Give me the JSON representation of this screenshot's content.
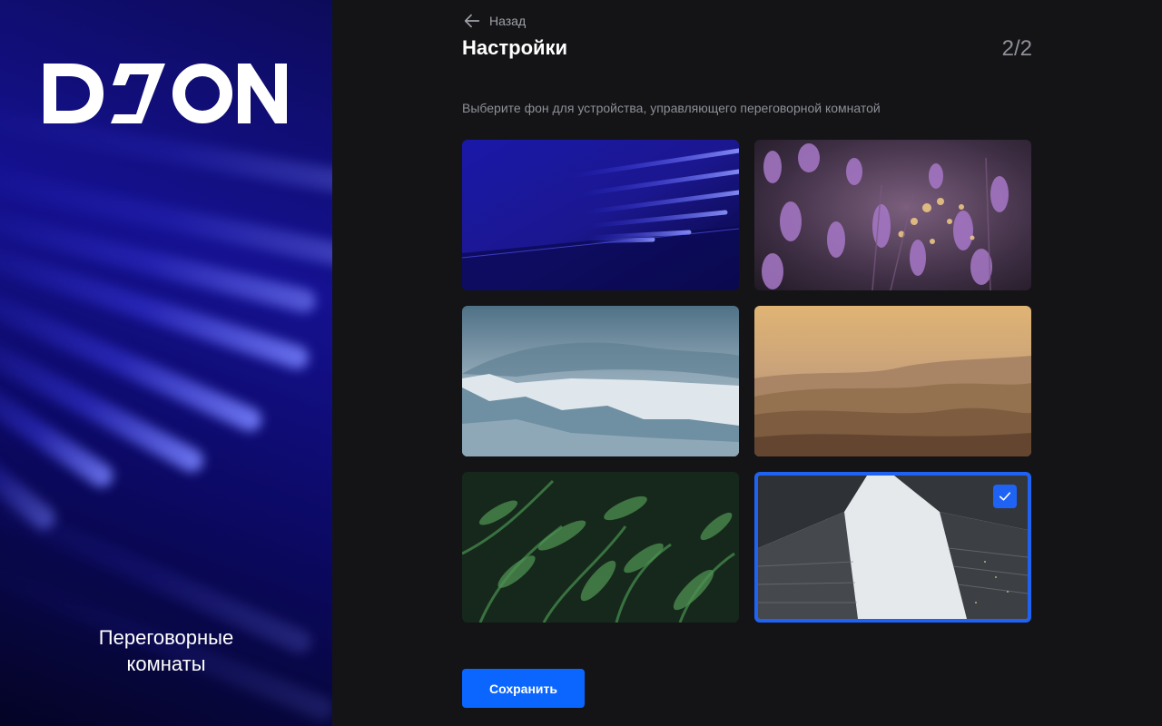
{
  "brand": {
    "logo_text": "DION",
    "caption": "Переговорные\nкомнаты"
  },
  "header": {
    "back_label": "Назад",
    "title": "Настройки",
    "step": "2/2"
  },
  "content": {
    "subtitle": "Выберите фон для устройства, управляющего переговорной комнатой",
    "backgrounds": [
      {
        "name": "blue-abstract",
        "selected": false
      },
      {
        "name": "lavender",
        "selected": false
      },
      {
        "name": "misty-mountains",
        "selected": false
      },
      {
        "name": "desert-dunes",
        "selected": false
      },
      {
        "name": "green-foliage",
        "selected": false
      },
      {
        "name": "skyscrapers",
        "selected": true
      }
    ]
  },
  "footer": {
    "save_label": "Сохранить"
  },
  "colors": {
    "accent": "#0a66ff",
    "background": "#141416",
    "muted_text": "#8d9097"
  },
  "icons": [
    "arrow-left-icon",
    "checkmark-icon"
  ]
}
